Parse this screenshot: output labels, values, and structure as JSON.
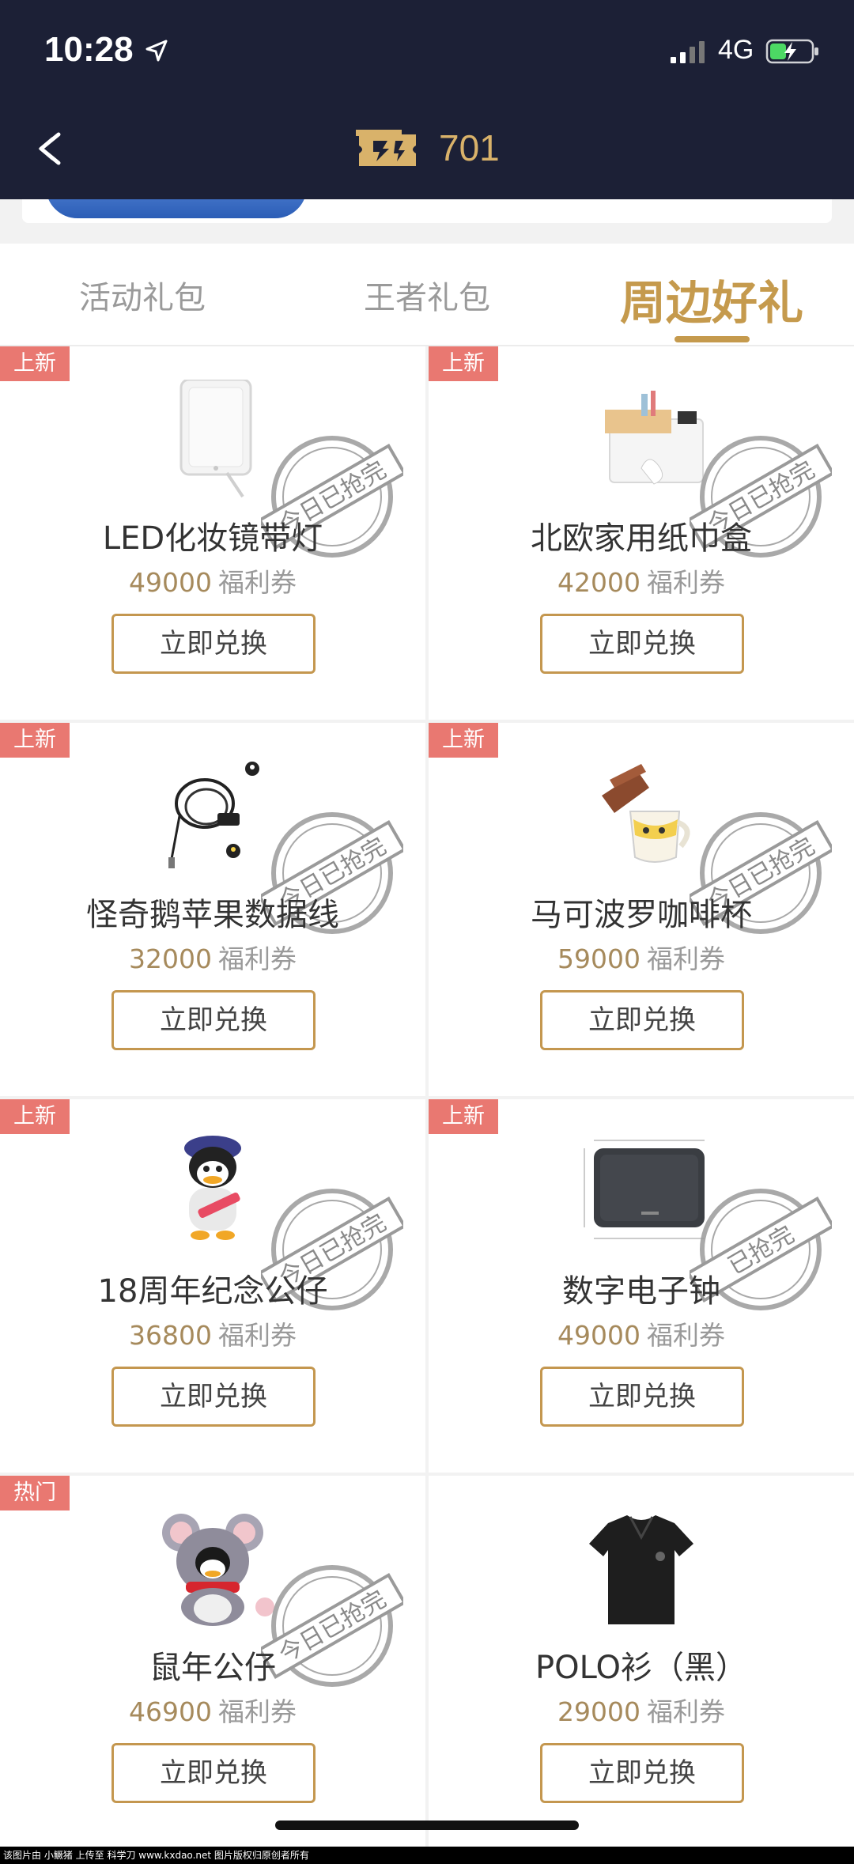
{
  "status_bar": {
    "time": "10:28",
    "network": "4G"
  },
  "header": {
    "coupon_count": "701"
  },
  "tabs": [
    {
      "label": "活动礼包"
    },
    {
      "label": "王者礼包"
    },
    {
      "label": "周边好礼"
    }
  ],
  "products": [
    {
      "badge": "上新",
      "name": "LED化妆镜带灯",
      "price": "49000",
      "unit": "福利券",
      "button": "立即兑换",
      "stamp": "今日已抢完"
    },
    {
      "badge": "上新",
      "name": "北欧家用纸巾盒",
      "price": "42000",
      "unit": "福利券",
      "button": "立即兑换",
      "stamp": "今日已抢完"
    },
    {
      "badge": "上新",
      "name": "怪奇鹅苹果数据线",
      "price": "32000",
      "unit": "福利券",
      "button": "立即兑换",
      "stamp": "今日已抢完"
    },
    {
      "badge": "上新",
      "name": "马可波罗咖啡杯",
      "price": "59000",
      "unit": "福利券",
      "button": "立即兑换",
      "stamp": "今日已抢完"
    },
    {
      "badge": "上新",
      "name": "18周年纪念公仔",
      "price": "36800",
      "unit": "福利券",
      "button": "立即兑换",
      "stamp": "今日已抢完"
    },
    {
      "badge": "上新",
      "name": "数字电子钟",
      "price": "49000",
      "unit": "福利券",
      "button": "立即兑换",
      "stamp": "已抢完"
    },
    {
      "badge": "热门",
      "name": "鼠年公仔",
      "price": "46900",
      "unit": "福利券",
      "button": "立即兑换",
      "stamp": "今日已抢完"
    },
    {
      "name": "POLO衫（黑）",
      "price": "29000",
      "unit": "福利券",
      "button": "立即兑换"
    }
  ],
  "footer": {
    "text": "该图片由 小鳜猪 上传至 科学刀 www.kxdao.net 图片版权归原创者所有"
  }
}
